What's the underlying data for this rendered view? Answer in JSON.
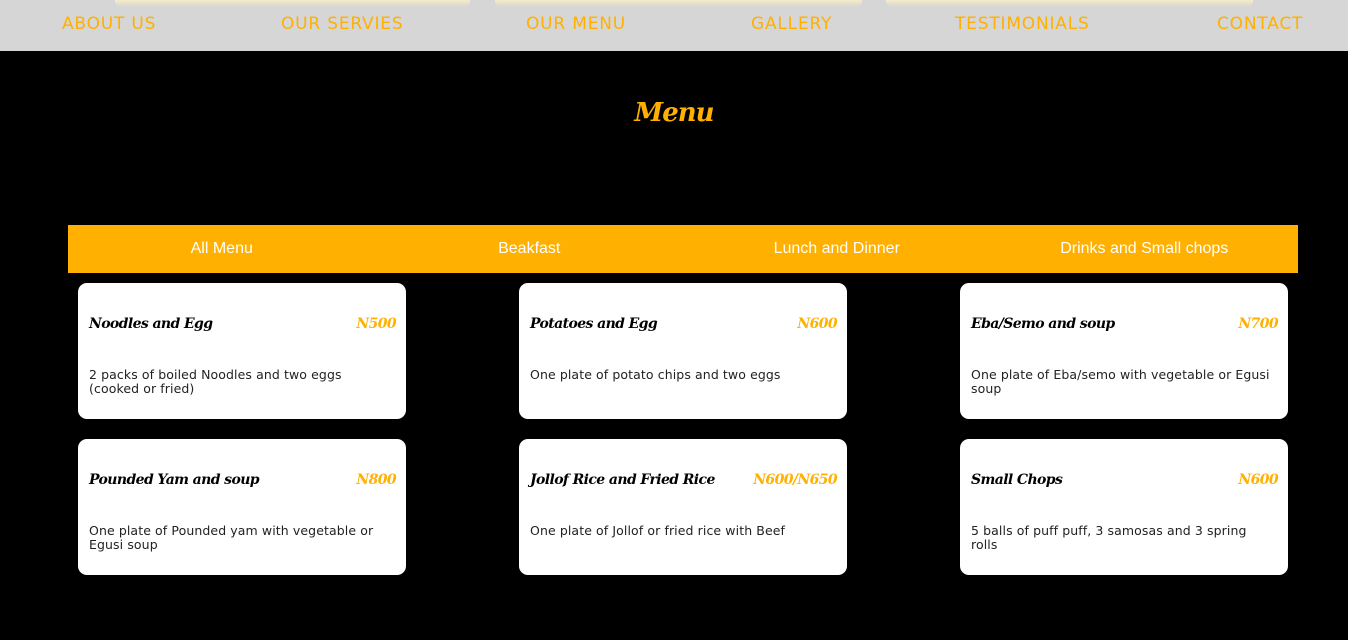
{
  "nav": {
    "links": [
      "ABOUT US",
      "OUR SERVIES",
      "OUR MENU",
      "GALLERY",
      "TESTIMONIALS",
      "CONTACT"
    ]
  },
  "menu_section": {
    "title": "Menu",
    "tabs": [
      "All Menu",
      "Beakfast",
      "Lunch and Dinner",
      "Drinks and Small chops"
    ],
    "items": [
      {
        "name": "Noodles and Egg",
        "price": "N500",
        "description": "2 packs of boiled Noodles and two eggs (cooked or fried)"
      },
      {
        "name": "Potatoes and Egg",
        "price": "N600",
        "description": "One plate of potato chips and two eggs"
      },
      {
        "name": "Eba/Semo and soup",
        "price": "N700",
        "description": "One plate of Eba/semo with vegetable or Egusi soup"
      },
      {
        "name": "Pounded Yam and soup",
        "price": "N800",
        "description": "One plate of Pounded yam with vegetable or Egusi soup"
      },
      {
        "name": "Jollof Rice and Fried Rice",
        "price": "N600/N650",
        "description": "One plate of Jollof or fried rice with Beef"
      },
      {
        "name": "Small Chops",
        "price": "N600",
        "description": "5 balls of puff puff, 3 samosas and 3 spring rolls"
      }
    ]
  },
  "colors": {
    "accent": "#ffb000",
    "background": "#000000",
    "navbar": "#d6d6d6",
    "card": "#ffffff"
  }
}
